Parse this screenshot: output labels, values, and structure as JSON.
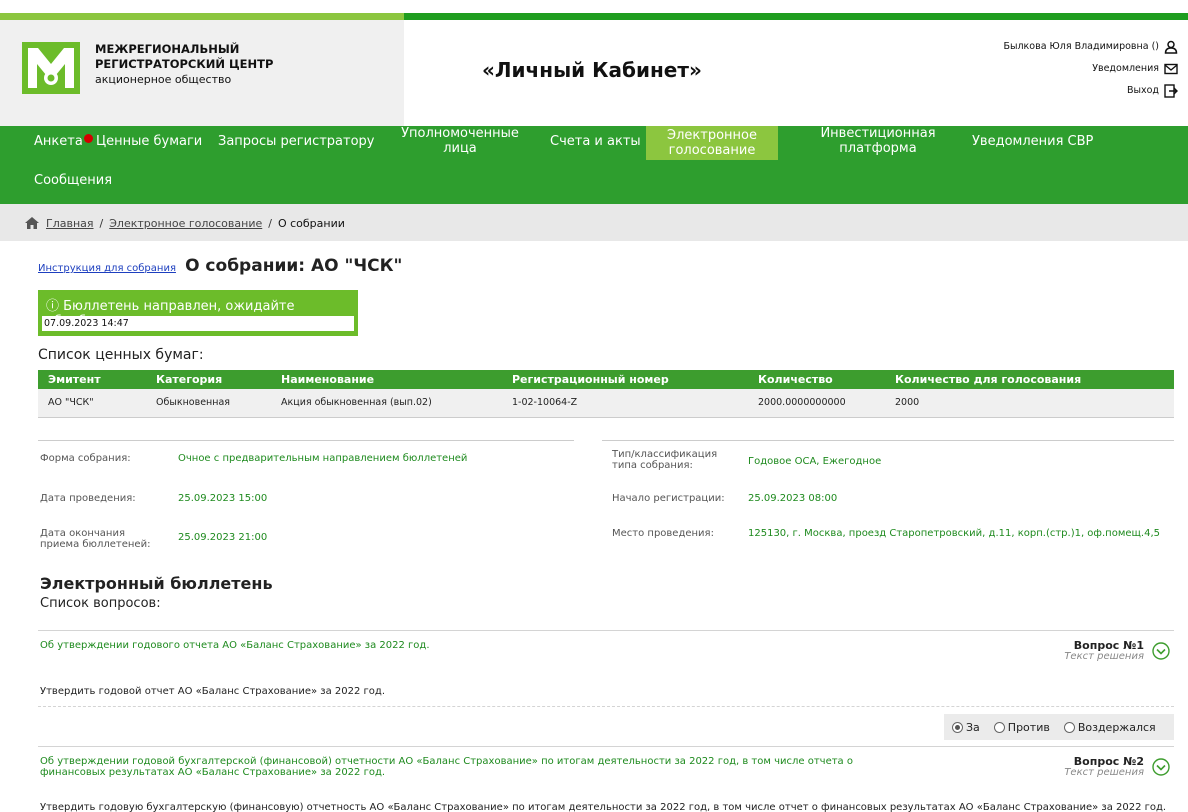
{
  "header": {
    "org_line1": "МЕЖРЕГИОНАЛЬНЫЙ",
    "org_line2": "РЕГИСТРАТОРСКИЙ ЦЕНТР",
    "org_line3": "акционерное общество",
    "title": "«Личный Кабинет»",
    "user_name": "Былкова Юля Владимировна ()",
    "notifications": "Уведомления",
    "logout": "Выход"
  },
  "nav": {
    "items": [
      "Анкета",
      "Ценные бумаги",
      "Запросы регистратору",
      "Уполномоченные лица",
      "Счета и акты",
      "Электронное голосование",
      "Инвестиционная платформа",
      "Уведомления СВР",
      "Сообщения"
    ]
  },
  "breadcrumb": {
    "home": "Главная",
    "section": "Электронное голосование",
    "current": "О собрании"
  },
  "page": {
    "instruction_link": "Инструкция для собрания",
    "title": "О собрании: АО \"ЧСК\"",
    "status_text": "ⓘ Бюллетень направлен, ожидайте обработки",
    "status_date": "07.09.2023 14:47",
    "securities_title": "Список ценных бумаг:"
  },
  "securities": {
    "columns": [
      "Эмитент",
      "Категория",
      "Наименование",
      "Регистрационный номер",
      "Количество",
      "Количество для голосования"
    ],
    "rows": [
      [
        "АО \"ЧСК\"",
        "Обыкновенная",
        "Акция обыкновенная (вып.02)",
        "1-02-10064-Z",
        "2000.0000000000",
        "2000"
      ]
    ]
  },
  "meeting": {
    "form_label": "Форма собрания:",
    "form_value": "Очное с предварительным направлением бюллетеней",
    "date_label": "Дата проведения:",
    "date_value": "25.09.2023 15:00",
    "end_label": "Дата окончания приема бюллетеней:",
    "end_value": "25.09.2023 21:00",
    "type_label": "Тип/классификация типа собрания:",
    "type_value": "Годовое ОСА, Ежегодное",
    "reg_label": "Начало регистрации:",
    "reg_value": "25.09.2023 08:00",
    "place_label": "Место проведения:",
    "place_value": "125130, г. Москва, проезд Старопетровский, д.11, корп.(стр.)1, оф.помещ.4,5"
  },
  "ballot": {
    "title": "Электронный бюллетень",
    "questions_title": "Список вопросов:",
    "questions": [
      {
        "title": "Об утверждении годового отчета АО «Баланс Страхование» за 2022 год.",
        "number": "Вопрос №1",
        "decision_label": "Текст решения",
        "decision": "Утвердить годовой отчет АО «Баланс Страхование» за 2022 год."
      },
      {
        "title": "Об утверждении годовой бухгалтерской (финансовой) отчетности АО «Баланс Страхование» по итогам деятельности за 2022 год, в том числе отчета о финансовых результатах АО «Баланс Страхование» за 2022 год.",
        "number": "Вопрос №2",
        "decision_label": "Текст решения",
        "decision": "Утвердить годовую бухгалтерскую (финансовую) отчетность АО «Баланс Страхование» по итогам деятельности за 2022 год, в том числе отчет о финансовых результатах АО «Баланс Страхование» за 2022 год."
      }
    ],
    "options": [
      "За",
      "Против",
      "Воздержался"
    ],
    "selected": "За"
  },
  "colors": {
    "green_dark": "#2e9e2e",
    "green_light": "#8cc63f",
    "link": "#1d3fbf"
  }
}
